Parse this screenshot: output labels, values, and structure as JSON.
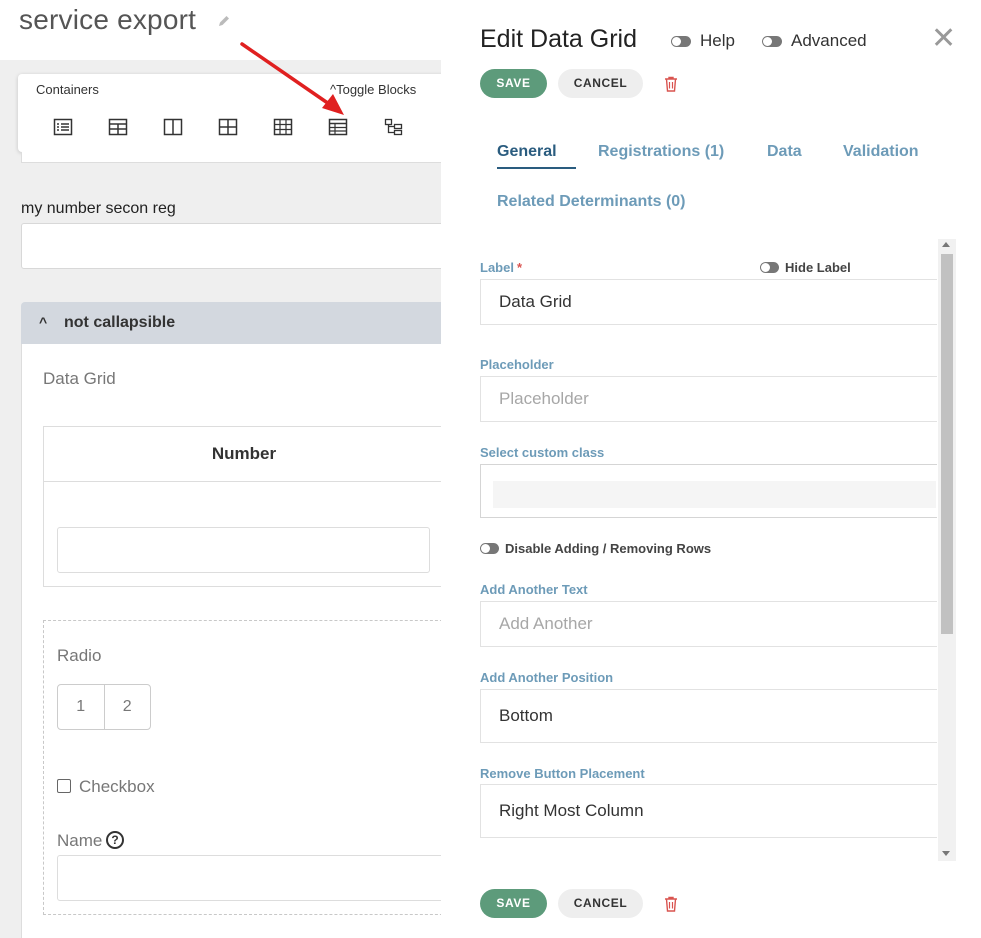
{
  "page": {
    "title": "service export",
    "builder": {
      "blocks_title": "Containers",
      "toggle_blocks": "^Toggle Blocks",
      "block_icons": [
        "list-icon",
        "table-icon",
        "columns-icon",
        "grid-icon",
        "grid-large-icon",
        "data-grid-icon",
        "tree-icon"
      ]
    },
    "form": {
      "field1_label": "my number secon reg",
      "panel_title": "not callapsible",
      "panel_caret": "^",
      "datagrid_label": "Data Grid",
      "datagrid_column": "Number",
      "radio_label": "Radio",
      "radio_options": [
        "1",
        "2"
      ],
      "checkbox_label": "Checkbox",
      "name_label": "Name",
      "name_help": "?"
    }
  },
  "modal": {
    "title": "Edit Data Grid",
    "help_toggle": "Help",
    "advanced_toggle": "Advanced",
    "close": "✕",
    "save": "SAVE",
    "cancel": "CANCEL",
    "tabs": [
      "General",
      "Registrations (1)",
      "Data",
      "Validation",
      "Related Determinants (0)"
    ],
    "active_tab": "General",
    "fields": {
      "label_label": "Label",
      "label_required": "*",
      "hide_label": "Hide Label",
      "label_value": "Data Grid",
      "placeholder_label": "Placeholder",
      "placeholder_placeholder": "Placeholder",
      "custom_class_label": "Select custom class",
      "disable_rows": "Disable Adding / Removing Rows",
      "add_another_text_label": "Add Another Text",
      "add_another_text_placeholder": "Add Another",
      "add_another_position_label": "Add Another Position",
      "add_another_position_value": "Bottom",
      "remove_button_label": "Remove Button Placement",
      "remove_button_value": "Right Most Column"
    }
  },
  "colors": {
    "save": "#5d9b7b",
    "tab_active": "#2a5c7f",
    "tab_inactive": "#6d9bb8",
    "label": "#6d9bb8",
    "trash": "#d9534f",
    "arrow": "#e02020"
  }
}
